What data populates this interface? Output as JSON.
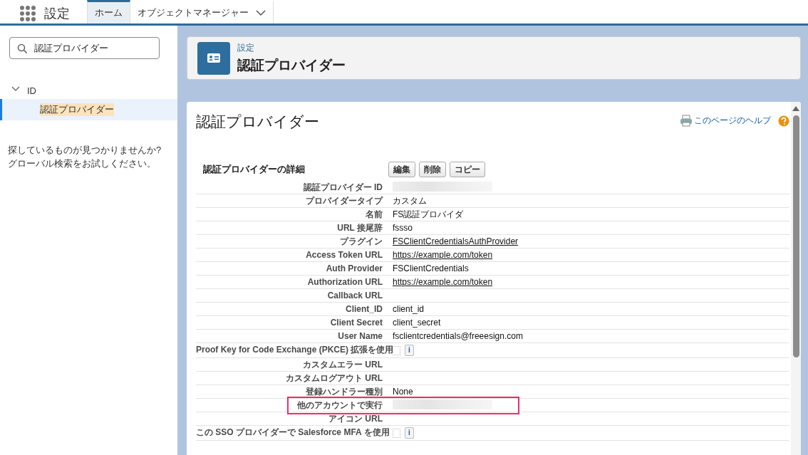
{
  "app": {
    "title": "設定"
  },
  "tabs": [
    {
      "label": "ホーム",
      "selected": true,
      "dropdown": false
    },
    {
      "label": "オブジェクトマネージャー",
      "selected": false,
      "dropdown": true
    }
  ],
  "sidebar": {
    "search": {
      "value": "認証プロバイダー"
    },
    "tree": [
      {
        "label": "ID",
        "expanded": true,
        "children": [
          {
            "label": "認証プロバイダー",
            "selected": true,
            "highlighted": true
          }
        ]
      }
    ],
    "help_text": [
      "探しているものが見つかりませんか?",
      "グローバル検索をお試しください。"
    ]
  },
  "page_header": {
    "breadcrumb": "設定",
    "title": "認証プロバイダー"
  },
  "detail": {
    "title": "認証プロバイダー",
    "help_link": "このページのヘルプ",
    "section_title": "認証プロバイダーの詳細",
    "buttons": [
      "編集",
      "削除",
      "コピー"
    ],
    "rows": [
      {
        "label": "認証プロバイダー ID",
        "kind": "redacted",
        "highlighted": false
      },
      {
        "label": "プロバイダータイプ",
        "kind": "text",
        "value": "カスタム",
        "highlighted": false
      },
      {
        "label": "名前",
        "kind": "text",
        "value": "FS認証プロバイダ",
        "highlighted": false
      },
      {
        "label": "URL 接尾辞",
        "kind": "text",
        "value": "fssso",
        "highlighted": false
      },
      {
        "label": "プラグイン",
        "kind": "link",
        "value": "FSClientCredentialsAuthProvider",
        "highlighted": false
      },
      {
        "label": "Access Token URL",
        "kind": "link",
        "value": "https://example.com/token",
        "highlighted": false
      },
      {
        "label": "Auth Provider",
        "kind": "text",
        "value": "FSClientCredentials",
        "highlighted": false
      },
      {
        "label": "Authorization URL",
        "kind": "link",
        "value": "https://example.com/token",
        "highlighted": false
      },
      {
        "label": "Callback URL",
        "kind": "empty",
        "highlighted": false
      },
      {
        "label": "Client_ID",
        "kind": "text",
        "value": "client_id",
        "highlighted": false
      },
      {
        "label": "Client Secret",
        "kind": "text",
        "value": "client_secret",
        "highlighted": false
      },
      {
        "label": "User Name",
        "kind": "text",
        "value": "fsclientcredentials@freeesign.com",
        "highlighted": false
      },
      {
        "label": "Proof Key for Code Exchange (PKCE) 拡張を使用",
        "kind": "checkbox",
        "checked": false,
        "info": "i",
        "highlighted": false
      },
      {
        "label": "カスタムエラー URL",
        "kind": "empty",
        "highlighted": false
      },
      {
        "label": "カスタムログアウト URL",
        "kind": "empty",
        "highlighted": false
      },
      {
        "label": "登録ハンドラー種別",
        "kind": "text",
        "value": "None",
        "highlighted": false
      },
      {
        "label": "他のアカウントで実行",
        "kind": "redacted",
        "highlighted": true
      },
      {
        "label": "アイコン URL",
        "kind": "empty",
        "highlighted": false
      },
      {
        "label": "この SSO プロバイダーで Salesforce MFA を使用",
        "kind": "checkbox",
        "checked": false,
        "info": "i",
        "highlighted": false
      }
    ]
  }
}
